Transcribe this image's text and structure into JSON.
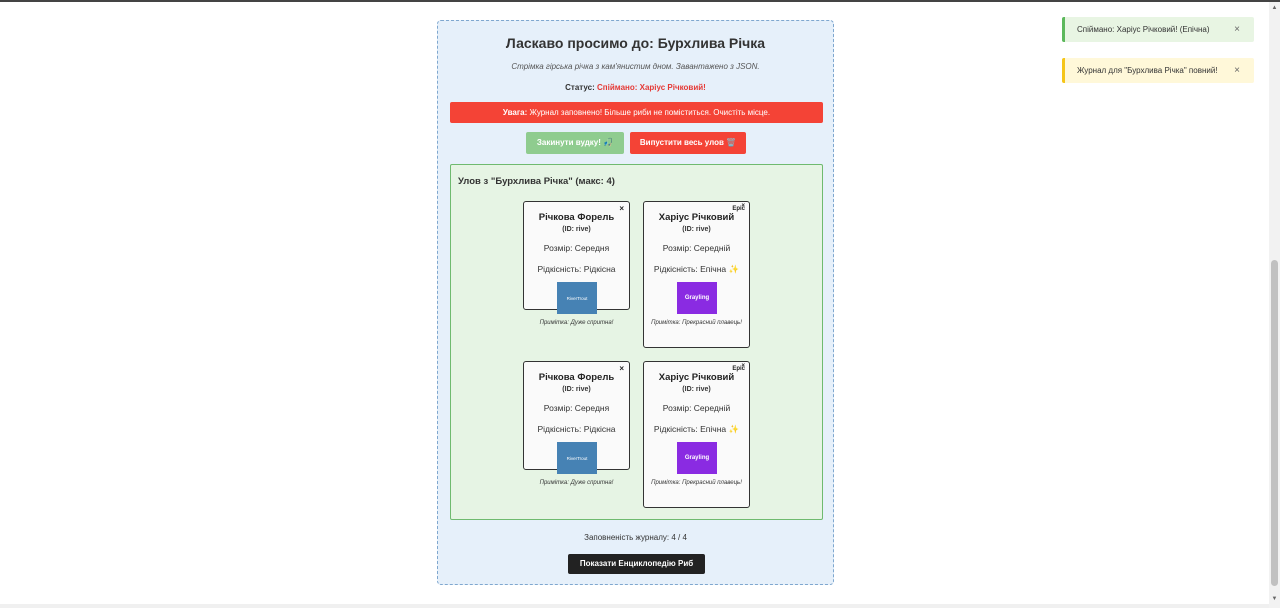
{
  "location": {
    "title": "Ласкаво просимо до: Бурхлива Річка",
    "description": "Стрімка гірська річка з кам'янистим дном. Завантажено з JSON.",
    "status_label": "Статус:",
    "status_value": "Спіймано: Харіус Річковий!"
  },
  "warning": {
    "label": "Увага:",
    "text": "Журнал заповнено! Більше риби не поміститься. Очистіть місце."
  },
  "actions": {
    "cast_label": "Закинути вудку! 🎣",
    "release_label": "Випустити весь улов 🗑️"
  },
  "catch": {
    "title": "Улов з \"Бурхлива Річка\" (макс: 4)",
    "cards": [
      {
        "name": "Річкова Форель",
        "id": "(ID: rive)",
        "size": "Розмір: Середня",
        "rarity": "Рідкісність: Рідкісна",
        "image_label": "RiverTrout",
        "note": "Примітка: Дуже спритна!",
        "close": "×"
      },
      {
        "name": "Харіус Річковий",
        "id": "(ID: rive)",
        "size": "Розмір: Середній",
        "rarity": "Рідкісність: Епічна ✨",
        "image_label": "Grayling",
        "note": "Примітка: Прекрасний плавець!",
        "badge": "Epic",
        "close": "×"
      },
      {
        "name": "Річкова Форель",
        "id": "(ID: rive)",
        "size": "Розмір: Середня",
        "rarity": "Рідкісність: Рідкісна",
        "image_label": "RiverTrout",
        "note": "Примітка: Дуже спритна!",
        "close": "×"
      },
      {
        "name": "Харіус Річковий",
        "id": "(ID: rive)",
        "size": "Розмір: Середній",
        "rarity": "Рідкісність: Епічна ✨",
        "image_label": "Grayling",
        "note": "Примітка: Прекрасний плавець!",
        "badge": "Epic",
        "close": "×"
      }
    ]
  },
  "journal": {
    "fill_text": "Заповненість журналу: 4 / 4",
    "encyclopedia_label": "Показати Енциклопедію Риб"
  },
  "toasts": [
    {
      "text": "Спіймано: Харіус Річковий! (Епічна)",
      "close": "×"
    },
    {
      "text": "Журнал для \"Бурхлива Річка\" повний!",
      "close": "×"
    }
  ],
  "colors": {
    "panel_bg": "#e6f0fa",
    "catch_bg": "#e6f4e4",
    "warning": "#f44336",
    "cast_button": "#8fcc8f",
    "trout_image": "#4682b4",
    "grayling_image": "#8a2be2",
    "toast_success_border": "#5cb85c",
    "toast_warning_border": "#f5c518"
  },
  "scrollbar": {
    "up": "▲",
    "down": "▼"
  }
}
